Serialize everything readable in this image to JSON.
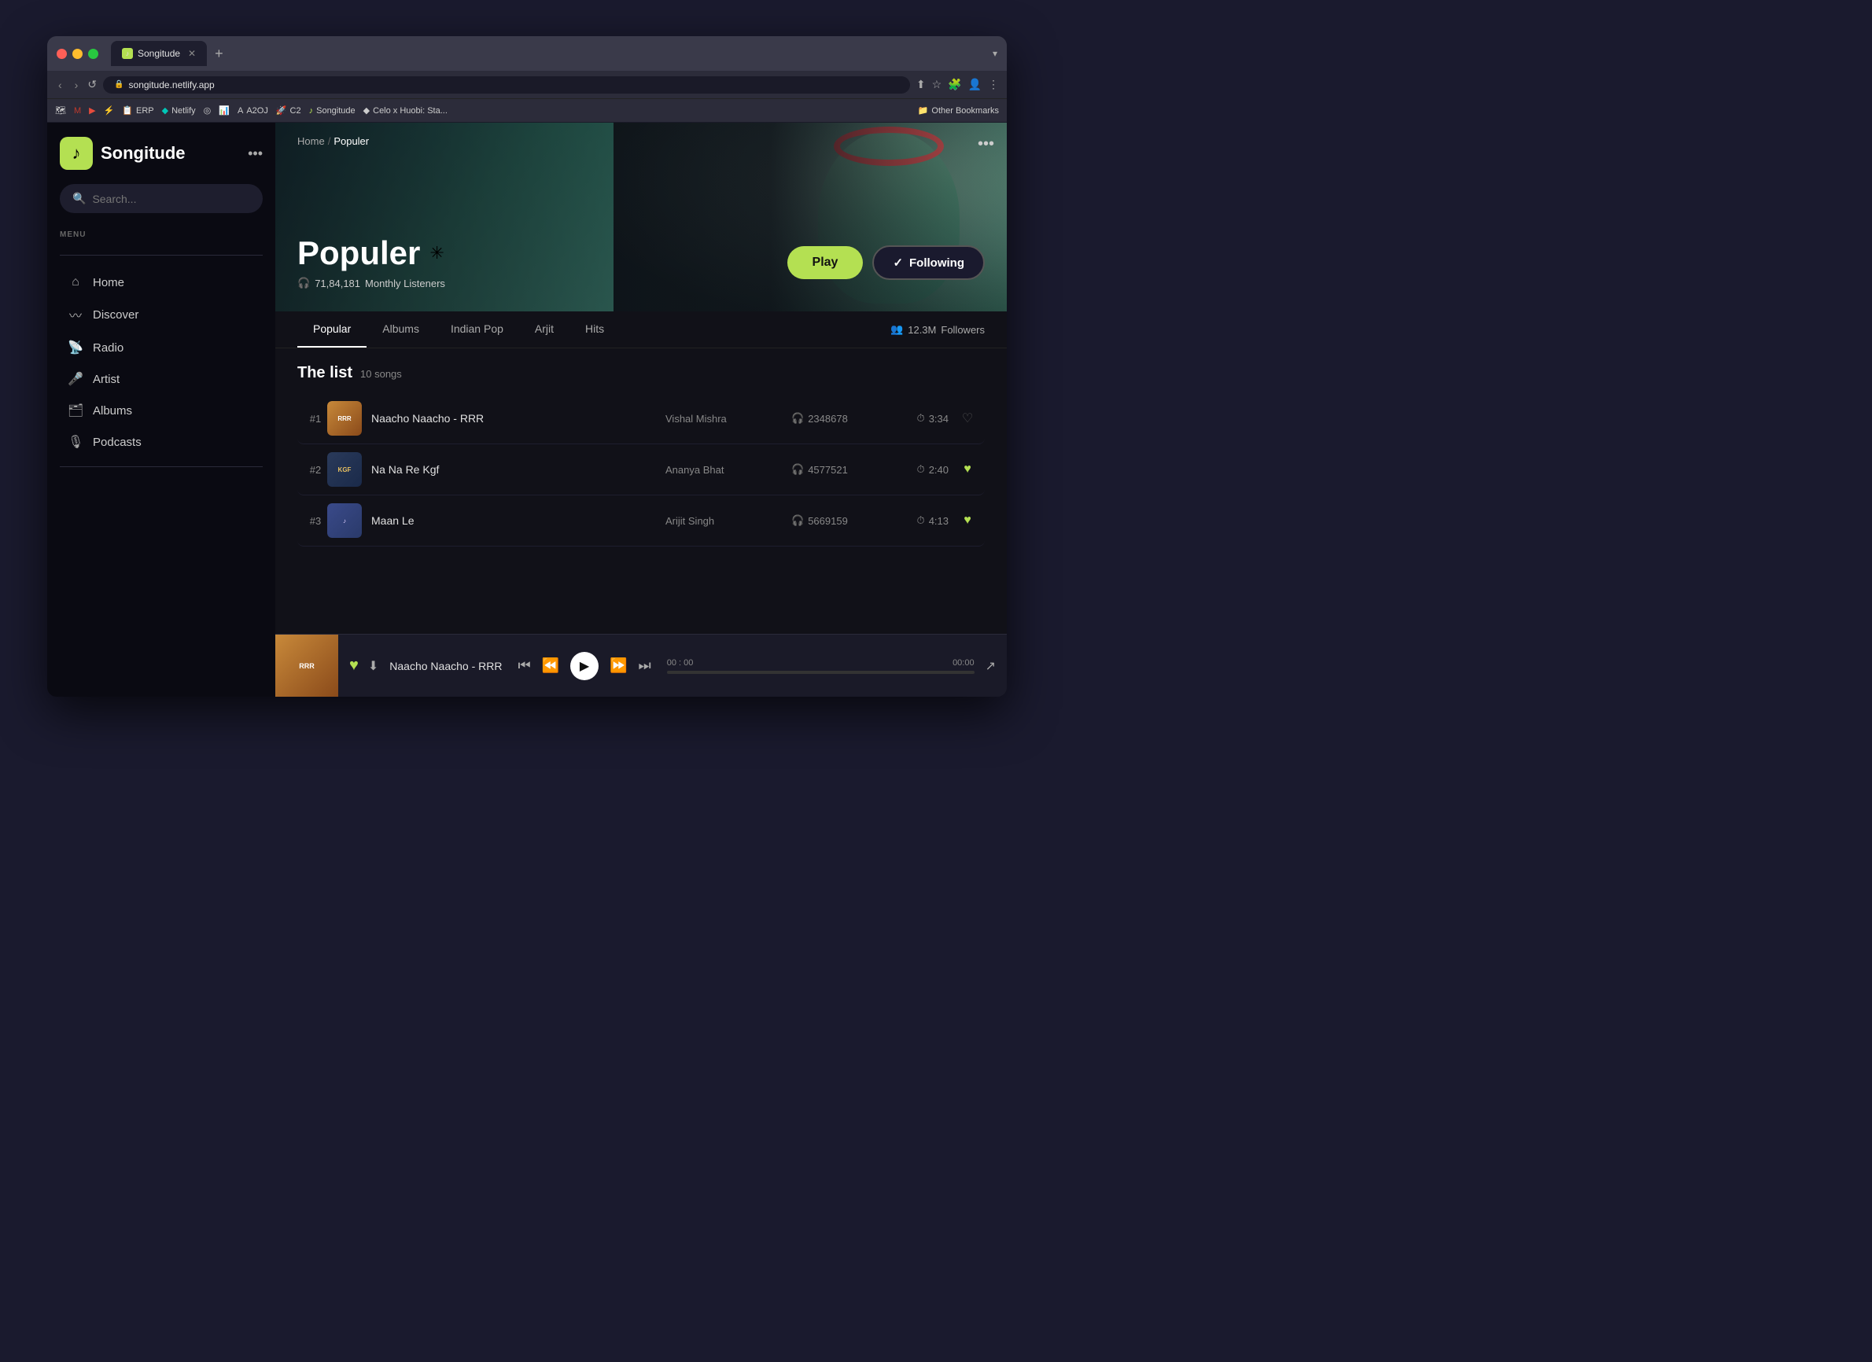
{
  "browser": {
    "tab_title": "Songitude",
    "tab_icon": "♪",
    "url": "songitude.netlify.app",
    "new_tab_label": "+",
    "bookmarks": [
      {
        "icon": "🗺",
        "label": ""
      },
      {
        "icon": "M",
        "label": "",
        "color": "#c0392b"
      },
      {
        "icon": "▶",
        "label": "",
        "color": "#e74c3c"
      },
      {
        "icon": "⚡",
        "label": "",
        "color": "#e67e22"
      },
      {
        "icon": "📋",
        "label": "ERP"
      },
      {
        "icon": "◆",
        "label": "Netlify",
        "color": "#00c7b7"
      },
      {
        "icon": "◎",
        "label": ""
      },
      {
        "icon": "📊",
        "label": ""
      },
      {
        "icon": "A",
        "label": "A2OJ"
      },
      {
        "icon": "🚀",
        "label": "C2"
      },
      {
        "icon": "♪",
        "label": "Songitude"
      },
      {
        "icon": "◆",
        "label": "Celo x Huobi: Sta..."
      }
    ],
    "other_bookmarks": "Other Bookmarks"
  },
  "app": {
    "logo": "♪",
    "title": "Songitude",
    "dots_label": "•••"
  },
  "sidebar": {
    "search_placeholder": "Search...",
    "menu_label": "MENU",
    "items": [
      {
        "icon": "⌂",
        "label": "Home",
        "id": "home"
      },
      {
        "icon": "〰",
        "label": "Discover",
        "id": "discover"
      },
      {
        "icon": "📡",
        "label": "Radio",
        "id": "radio"
      },
      {
        "icon": "🎤",
        "label": "Artist",
        "id": "artist"
      },
      {
        "icon": "🗂",
        "label": "Albums",
        "id": "albums"
      },
      {
        "icon": "🎙",
        "label": "Podcasts",
        "id": "podcasts"
      }
    ]
  },
  "breadcrumb": {
    "home": "Home",
    "separator": "/",
    "current": "Populer"
  },
  "hero": {
    "title": "Populer",
    "badge": "✳",
    "listeners_icon": "🎧",
    "listeners_count": "71,84,181",
    "listeners_label": "Monthly Listeners",
    "play_btn": "Play",
    "following_btn": "Following",
    "following_check": "✓",
    "three_dots": "•••"
  },
  "tabs": {
    "items": [
      {
        "label": "Popular",
        "active": true
      },
      {
        "label": "Albums",
        "active": false
      },
      {
        "label": "Indian Pop",
        "active": false
      },
      {
        "label": "Arjit",
        "active": false
      },
      {
        "label": "Hits",
        "active": false
      }
    ],
    "followers_icon": "👥",
    "followers_count": "12.3M",
    "followers_label": "Followers"
  },
  "song_list": {
    "title": "The list",
    "count": "10 songs",
    "songs": [
      {
        "num": "#1",
        "title": "Naacho Naacho - RRR",
        "artist": "Vishal Mishra",
        "plays_icon": "🎧",
        "plays": "2348678",
        "duration_icon": "⏱",
        "duration": "3:34",
        "liked": false,
        "thumb_class": "thumb-rrr",
        "thumb_text": "RRR"
      },
      {
        "num": "#2",
        "title": "Na Na Re Kgf",
        "artist": "Ananya Bhat",
        "plays_icon": "🎧",
        "plays": "4577521",
        "duration_icon": "⏱",
        "duration": "2:40",
        "liked": true,
        "thumb_class": "thumb-kgf",
        "thumb_text": "KGF"
      },
      {
        "num": "#3",
        "title": "Maan Le",
        "artist": "Arijit Singh",
        "plays_icon": "🎧",
        "plays": "5669159",
        "duration_icon": "⏱",
        "duration": "4:13",
        "liked": true,
        "thumb_class": "thumb-maan",
        "thumb_text": "♪"
      }
    ]
  },
  "player": {
    "title": "Naacho Naacho - RRR",
    "time_current": "00 : 00",
    "time_total": "00:00",
    "progress_pct": 0,
    "heart_icon": "♥",
    "download_icon": "⬇",
    "skip_back": "⏮",
    "rewind": "⏪",
    "play": "▶",
    "forward": "⏩",
    "skip_fwd": "⏭",
    "share": "↗"
  }
}
